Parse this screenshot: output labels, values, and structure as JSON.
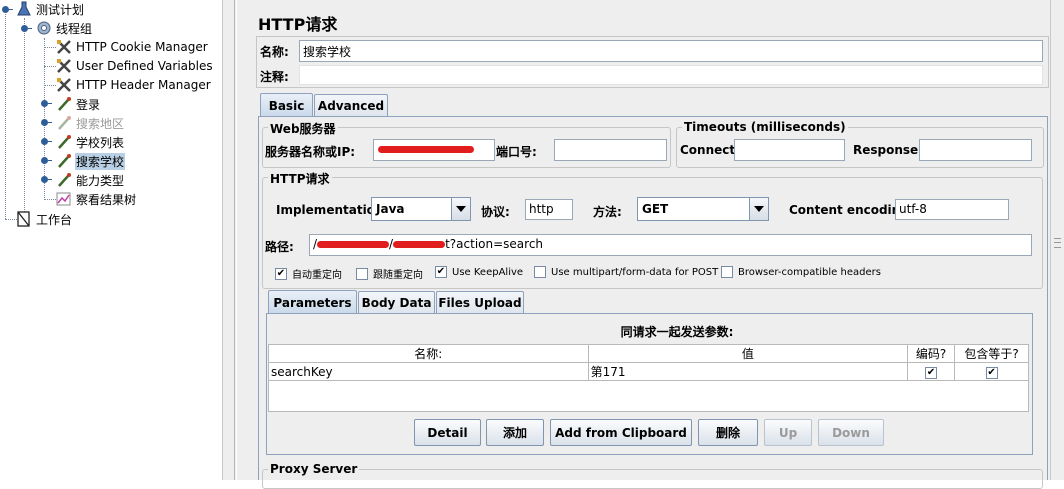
{
  "tree": {
    "test_plan": "测试计划",
    "thread_group": "线程组",
    "items": [
      {
        "label": "HTTP Cookie Manager",
        "icon": "tools-icon"
      },
      {
        "label": "User Defined Variables",
        "icon": "tools-icon"
      },
      {
        "label": "HTTP Header Manager",
        "icon": "tools-icon"
      },
      {
        "label": "登录",
        "icon": "pipette-icon"
      },
      {
        "label": "搜索地区",
        "icon": "pipette-icon"
      },
      {
        "label": "学校列表",
        "icon": "pipette-icon"
      },
      {
        "label": "搜索学校",
        "icon": "pipette-icon"
      },
      {
        "label": "能力类型",
        "icon": "pipette-icon"
      },
      {
        "label": "察看结果树",
        "icon": "graph-icon"
      }
    ],
    "workbench": "工作台"
  },
  "panel": {
    "title": "HTTP请求",
    "name_label": "名称:",
    "name_value": "搜索学校",
    "comment_label": "注释:",
    "comment_value": "",
    "tabs": [
      "Basic",
      "Advanced"
    ],
    "web_server": {
      "title": "Web服务器",
      "server_label": "服务器名称或IP:",
      "port_label": "端口号:",
      "port_value": ""
    },
    "timeouts": {
      "title": "Timeouts (milliseconds)",
      "connect_label": "Connect:",
      "response_label": "Response:"
    },
    "http_request": {
      "title": "HTTP请求",
      "impl_label": "Implementation:",
      "impl_value": "Java",
      "protocol_label": "协议:",
      "protocol_value": "http",
      "method_label": "方法:",
      "method_value": "GET",
      "encoding_label": "Content encoding:",
      "encoding_value": "utf-8",
      "path_label": "路径:",
      "path_prefix": "/",
      "path_mid": "/",
      "path_suffix": "t?action=search"
    },
    "options": [
      {
        "label": "自动重定向",
        "checked": true
      },
      {
        "label": "跟随重定向",
        "checked": false
      },
      {
        "label": "Use KeepAlive",
        "checked": true
      },
      {
        "label": "Use multipart/form-data for POST",
        "checked": false
      },
      {
        "label": "Browser-compatible headers",
        "checked": false
      }
    ],
    "subtabs": [
      "Parameters",
      "Body Data",
      "Files Upload"
    ],
    "params_caption": "同请求一起发送参数:",
    "params_columns": [
      "名称:",
      "值",
      "编码?",
      "包含等于?"
    ],
    "params_rows": [
      {
        "name": "searchKey",
        "value": "第171",
        "encode": true,
        "include_equals": true
      }
    ],
    "buttons": {
      "detail": "Detail",
      "add": "添加",
      "clipboard": "Add from Clipboard",
      "delete": "删除",
      "up": "Up",
      "down": "Down"
    },
    "proxy_title": "Proxy Server",
    "check_mark": "✔"
  }
}
